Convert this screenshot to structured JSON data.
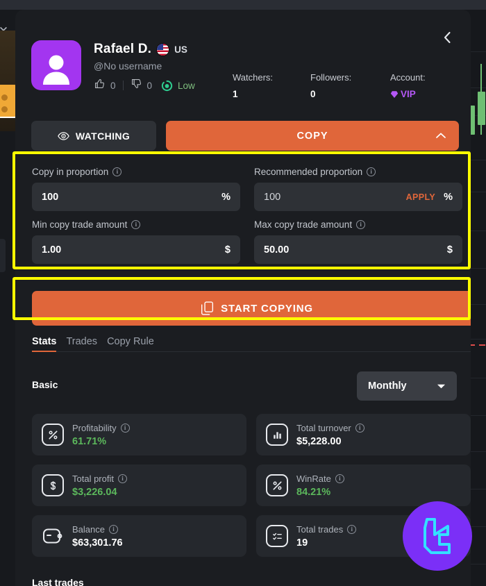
{
  "panel": {
    "back_icon": "chevron-left-icon"
  },
  "profile": {
    "avatar_icon": "user-avatar-icon",
    "name": "Rafael D.",
    "flag_icon": "us-flag-icon",
    "country": "US",
    "username": "@No username",
    "thumbs_up_icon": "thumbs-up-icon",
    "thumbs_up_count": "0",
    "thumbs_down_icon": "thumbs-down-icon",
    "thumbs_down_count": "0",
    "risk_icon": "risk-gauge-icon",
    "risk_label": "Low",
    "avatar_color": "#a335f0"
  },
  "metrics": [
    {
      "label": "Watchers:",
      "value": "1"
    },
    {
      "label": "Followers:",
      "value": "0"
    },
    {
      "label": "Account:",
      "value": "VIP",
      "icon": "diamond-icon",
      "color": "#b558f6"
    }
  ],
  "actions": {
    "watching_label": "WATCHING",
    "watching_icon": "eye-icon",
    "copy_label": "COPY",
    "copy_caret_icon": "chevron-up-icon",
    "accent_color": "#e0663a"
  },
  "form": {
    "highlight_color": "#ffff00",
    "fields": [
      {
        "label": "Copy in proportion",
        "info_icon": "info-icon",
        "value": "100",
        "unit": "%",
        "apply_label": "",
        "bold": true
      },
      {
        "label": "Recommended proportion",
        "info_icon": "info-icon",
        "value": "100",
        "unit": "%",
        "apply_label": "APPLY",
        "bold": false
      },
      {
        "label": "Min copy trade amount",
        "info_icon": "info-icon",
        "value": "1.00",
        "unit": "$",
        "apply_label": "",
        "bold": true
      },
      {
        "label": "Max copy trade amount",
        "info_icon": "info-icon",
        "value": "50.00",
        "unit": "$",
        "apply_label": "",
        "bold": true
      }
    ]
  },
  "start_button": {
    "label": "START COPYING",
    "icon": "copy-pages-icon"
  },
  "tabs": [
    {
      "label": "Stats",
      "active": true
    },
    {
      "label": "Trades",
      "active": false
    },
    {
      "label": "Copy Rule",
      "active": false
    }
  ],
  "stats": {
    "section_title": "Basic",
    "period_value": "Monthly",
    "period_caret_icon": "chevron-down-icon",
    "cards_left": [
      {
        "icon": "percent-badge-icon",
        "label": "Profitability",
        "info_icon": "info-icon",
        "value": "61.71%",
        "green": true
      },
      {
        "icon": "dollar-badge-icon",
        "label": "Total profit",
        "info_icon": "info-icon",
        "value": "$3,226.04",
        "green": true
      },
      {
        "icon": "wallet-icon",
        "label": "Balance",
        "info_icon": "info-icon",
        "value": "$63,301.76",
        "green": false
      }
    ],
    "cards_right": [
      {
        "icon": "bar-chart-icon",
        "label": "Total turnover",
        "info_icon": "info-icon",
        "value": "$5,228.00",
        "green": false
      },
      {
        "icon": "percent-badge-icon",
        "label": "WinRate",
        "info_icon": "info-icon",
        "value": "84.21%",
        "green": true
      },
      {
        "icon": "checklist-icon",
        "label": "Total trades",
        "info_icon": "info-icon",
        "value": "19",
        "green": false
      }
    ]
  },
  "footer": {
    "last_trades_title": "Last trades"
  },
  "watermark": {
    "icon": "brand-logo-icon",
    "circle_color": "#7b2ff7",
    "mark_color": "#33e0ff"
  }
}
